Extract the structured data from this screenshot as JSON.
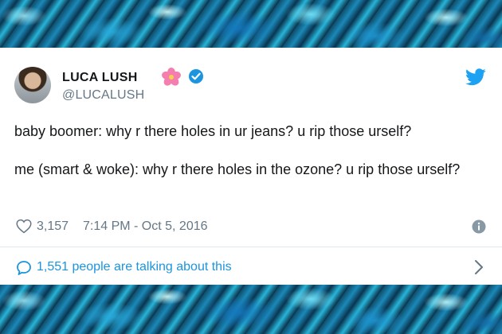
{
  "user": {
    "display_name": "LUCA LUSH",
    "handle": "@LUCALUSH",
    "name_emoji_icon": "hibiscus-flower-icon",
    "verified_icon": "verified-badge-icon",
    "platform_icon": "twitter-bird-icon"
  },
  "tweet": {
    "lines": [
      "baby boomer: why r there holes in ur jeans? u rip those urself?",
      "me (smart & woke): why r there holes in the ozone? u rip those urself?"
    ],
    "likes": "3,157",
    "timestamp": "7:14 PM - Oct 5, 2016"
  },
  "footer": {
    "talking_label": "1,551 people are talking about this"
  },
  "colors": {
    "accent": "#1b95e0",
    "text": "#14171a",
    "muted": "#657786"
  }
}
